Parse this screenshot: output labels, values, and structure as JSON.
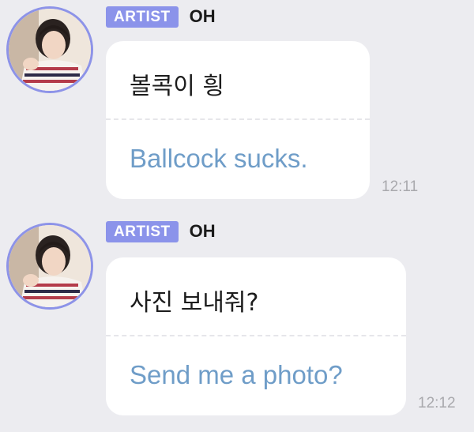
{
  "messages": [
    {
      "badge": "ARTIST",
      "sender": "OH",
      "korean": "볼콕이 힁",
      "english": "Ballcock sucks.",
      "time": "12:11"
    },
    {
      "badge": "ARTIST",
      "sender": "OH",
      "korean": "사진 보내줘?",
      "english": "Send me a photo?",
      "time": "12:12"
    }
  ],
  "colors": {
    "background": "#ececf0",
    "badge": "#8b93ea",
    "avatar_ring": "#8d93e8",
    "english_text": "#6f9dc8",
    "time_text": "#a9a9ad"
  },
  "icons": {
    "avatar": "profile-photo"
  }
}
